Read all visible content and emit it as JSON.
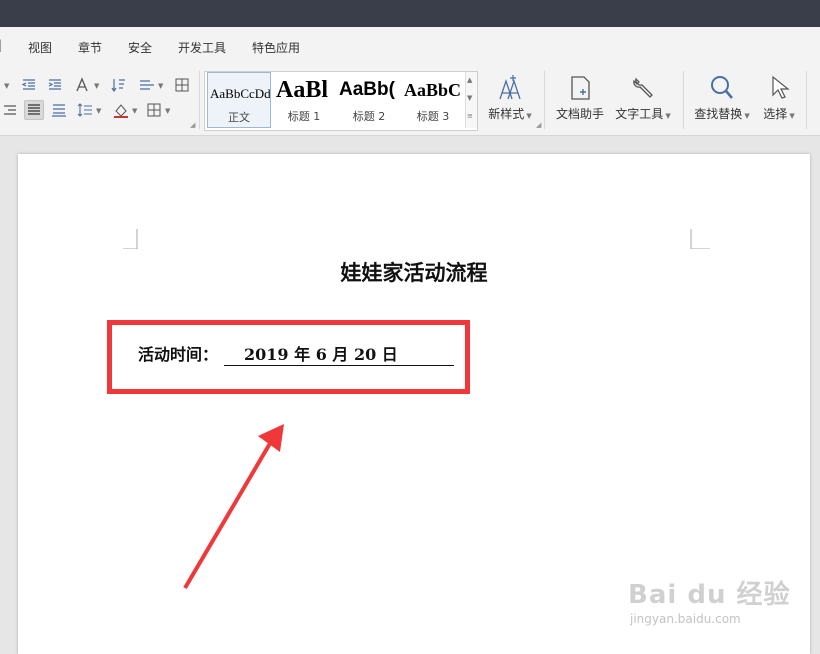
{
  "menubar": {
    "tabs": [
      "视图",
      "章节",
      "安全",
      "开发工具",
      "特色应用"
    ]
  },
  "ribbon": {
    "styles": [
      {
        "sample": "AaBbCcDd",
        "name": "正文"
      },
      {
        "sample": "AaBl",
        "name": "标题 1"
      },
      {
        "sample": "AaBb(",
        "name": "标题 2"
      },
      {
        "sample": "AaBbC",
        "name": "标题 3"
      }
    ],
    "new_style_label": "新样式",
    "doc_helper_label": "文档助手",
    "text_tools_label": "文字工具",
    "find_replace_label": "查找替换",
    "select_label": "选择",
    "icons": {
      "decrease_indent": "decrease-indent-icon",
      "increase_indent": "increase-indent-icon",
      "text_direction": "text-direction-icon",
      "sort": "sort-icon",
      "line_spacing": "line-spacing-icon",
      "borders": "borders-icon",
      "justify": "justify-align-icon",
      "distributed": "distributed-align-icon",
      "shading": "shading-icon",
      "table": "table-icon"
    }
  },
  "document": {
    "title": "娃娃家活动流程",
    "field_label": "活动时间：",
    "field_value": "2019 年 6 月 20 日"
  },
  "annotation": {
    "highlight_color": "#f0383b"
  },
  "watermark": {
    "brand": "Bai du 经验",
    "url": "jingyan.baidu.com"
  }
}
